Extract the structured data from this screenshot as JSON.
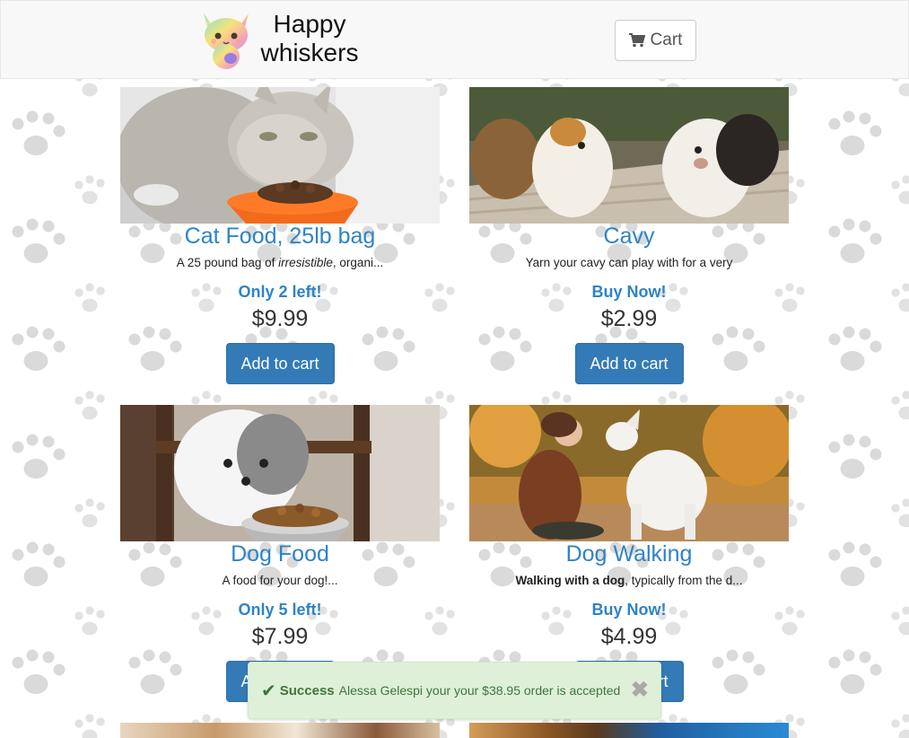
{
  "header": {
    "brand_line1": "Happy",
    "brand_line2": "whiskers",
    "cart_label": "Cart"
  },
  "products": [
    {
      "title": "Cat Food, 25lb bag",
      "desc_pre": "A 25 pound bag of ",
      "desc_em": "irresistible",
      "desc_post": ", organi...",
      "stock": "Only 2 left!",
      "price": "$9.99",
      "button": "Add to cart"
    },
    {
      "title": "Cavy",
      "desc": "Yarn your cavy can play with for a very",
      "stock": "Buy Now!",
      "price": "$2.99",
      "button": "Add to cart"
    },
    {
      "title": "Dog Food",
      "desc": "A food for your dog!...",
      "stock": "Only 5 left!",
      "price": "$7.99",
      "button": "Add to cart"
    },
    {
      "title": "Dog Walking",
      "desc_strong": "Walking with a dog",
      "desc_post": ", typically from the d...",
      "stock": "Buy Now!",
      "price": "$4.99",
      "button": "Add to cart"
    }
  ],
  "toast": {
    "icon": "check-icon",
    "title": "Success",
    "message": "Alessa Gelespi your your $38.95 order is accepted"
  },
  "colors": {
    "accent": "#337ab7",
    "link": "#2f83c6",
    "success_bg": "#dff0d8",
    "success_text": "#3c763d"
  }
}
